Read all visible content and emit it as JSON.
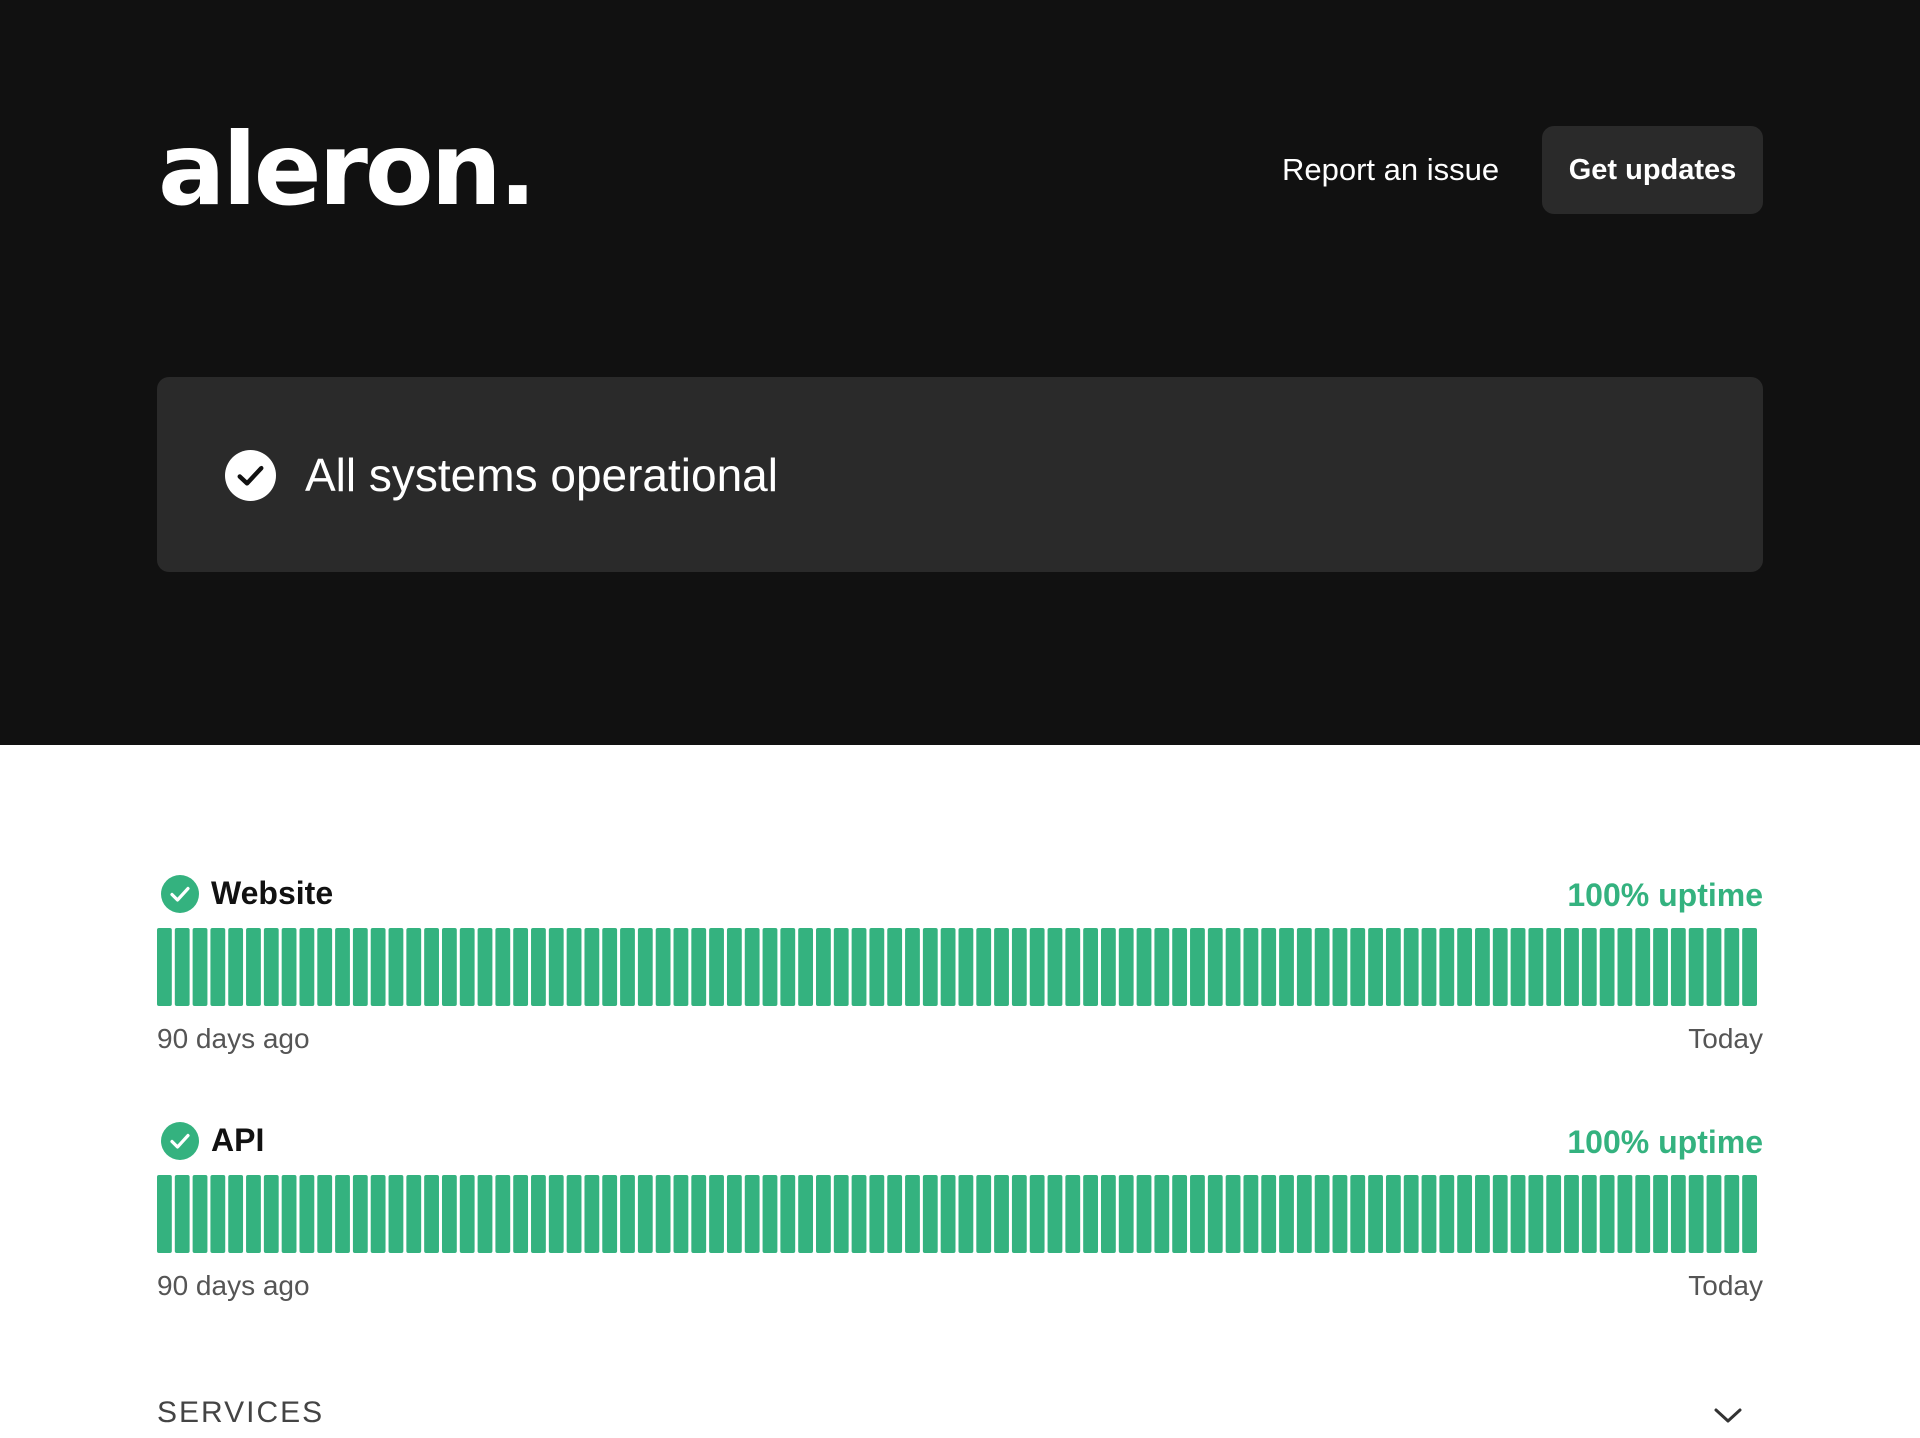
{
  "header": {
    "logo_text": "aleron.",
    "report_link_label": "Report an issue",
    "updates_button_label": "Get updates"
  },
  "overall_status": {
    "text": "All systems operational",
    "icon": "check-circle-icon"
  },
  "components": [
    {
      "name": "Website",
      "uptime_label": "100% uptime",
      "status_icon": "check-circle-icon",
      "status_color": "#34b27f",
      "days_shown": 90,
      "days_up": 90,
      "range_start_label": "90 days ago",
      "range_end_label": "Today"
    },
    {
      "name": "API",
      "uptime_label": "100% uptime",
      "status_icon": "check-circle-icon",
      "status_color": "#34b27f",
      "days_shown": 90,
      "days_up": 90,
      "range_start_label": "90 days ago",
      "range_end_label": "Today"
    }
  ],
  "sections": {
    "services_label": "SERVICES",
    "services_toggle_icon": "chevron-down-icon"
  },
  "colors": {
    "hero_background": "#111111",
    "card_background": "#2a2a2a",
    "operational_green": "#34b27f"
  }
}
